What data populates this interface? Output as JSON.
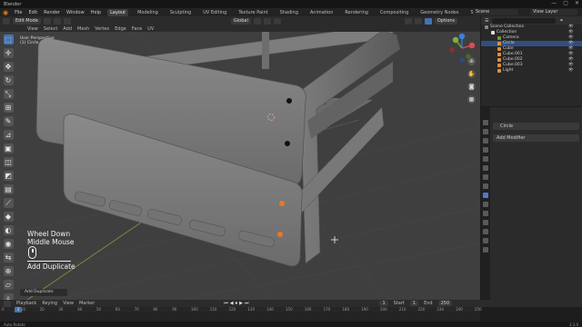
{
  "app_title": "Blender",
  "window_controls": [
    "—",
    "▢",
    "✕"
  ],
  "menus": [
    "File",
    "Edit",
    "Render",
    "Window",
    "Help"
  ],
  "workspaces": [
    "Layout",
    "Modeling",
    "Sculpting",
    "UV Editing",
    "Texture Paint",
    "Shading",
    "Animation",
    "Rendering",
    "Compositing",
    "Geometry Nodes",
    "Scripting"
  ],
  "active_workspace": "Layout",
  "scene": "Scene",
  "view_layer": "View Layer",
  "viewport_header": {
    "mode": "Edit Mode",
    "transform": "Global",
    "options": "Options"
  },
  "viewport_menus": [
    "View",
    "Select",
    "Add",
    "Mesh",
    "Vertex",
    "Edge",
    "Face",
    "UV"
  ],
  "overlay_text": {
    "view_name": "User Perspective",
    "object_name": "(1) Circle"
  },
  "key_hint": {
    "line1": "Wheel Down",
    "line2": "Middle Mouse",
    "action": "Add Duplicate"
  },
  "operator_panel": "Add Duplicate",
  "outliner": {
    "title": "Scene Collection",
    "rows": [
      {
        "label": "Scene Collection",
        "indent": 0,
        "icon_color": "#888888",
        "selected": false
      },
      {
        "label": "Collection",
        "indent": 1,
        "icon_color": "#dddddd",
        "selected": false
      },
      {
        "label": "Camera",
        "indent": 2,
        "icon_color": "#6e9b3c",
        "selected": false
      },
      {
        "label": "Circle",
        "indent": 2,
        "icon_color": "#e0913c",
        "selected": true
      },
      {
        "label": "Cube",
        "indent": 2,
        "icon_color": "#e0913c",
        "selected": false
      },
      {
        "label": "Cube.001",
        "indent": 2,
        "icon_color": "#e0913c",
        "selected": false
      },
      {
        "label": "Cube.002",
        "indent": 2,
        "icon_color": "#e0913c",
        "selected": false
      },
      {
        "label": "Cube.003",
        "indent": 2,
        "icon_color": "#e0913c",
        "selected": false
      },
      {
        "label": "Light",
        "indent": 2,
        "icon_color": "#e0913c",
        "selected": false
      }
    ]
  },
  "properties": {
    "object_name": "Circle",
    "add_modifier": "Add Modifier"
  },
  "timeline": {
    "menus": [
      "Playback",
      "Keying",
      "View",
      "Marker"
    ],
    "current_frame": "1",
    "start_label": "Start",
    "start": "1",
    "end_label": "End",
    "end": "250",
    "ruler_ticks": [
      "0",
      "10",
      "20",
      "30",
      "40",
      "50",
      "60",
      "70",
      "80",
      "90",
      "100",
      "110",
      "120",
      "130",
      "140",
      "150",
      "160",
      "170",
      "180",
      "190",
      "200",
      "210",
      "220",
      "230",
      "240",
      "250"
    ]
  },
  "status": {
    "left": "Auto Rotate",
    "right": "3.3.0"
  },
  "colors": {
    "accent": "#4772b3",
    "selection": "#334d80",
    "viewport_bg": "#3f3f3f",
    "orange_vertex": "#e8782a"
  }
}
